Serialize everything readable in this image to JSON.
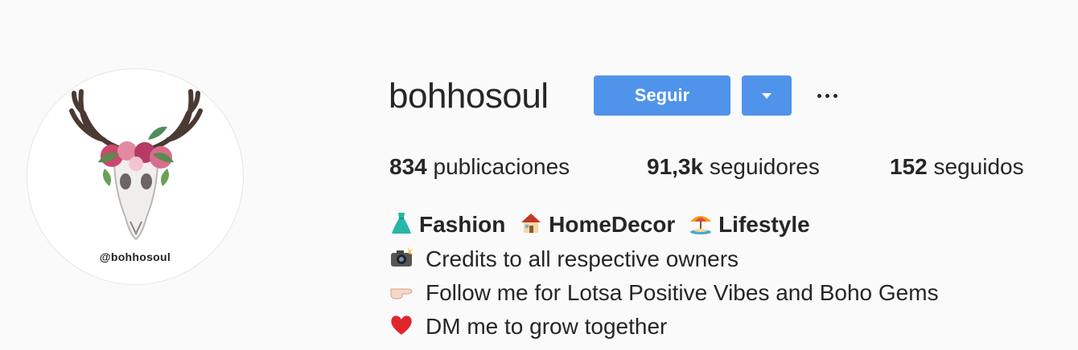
{
  "profile": {
    "avatar_handle": "@bohhosoul",
    "username": "bohhosoul",
    "follow_label": "Seguir"
  },
  "stats": {
    "posts_count": "834",
    "posts_label": "publicaciones",
    "followers_count": "91,3k",
    "followers_label": "seguidores",
    "following_count": "152",
    "following_label": "seguidos"
  },
  "bio": {
    "line1": {
      "fashion": "Fashion",
      "homedecor": "HomeDecor",
      "lifestyle": "Lifestyle"
    },
    "line2": "Credits to all respective owners",
    "line3": "Follow me for Lotsa Positive Vibes and Boho Gems",
    "line4": "DM me to grow together"
  },
  "icons": {
    "dress": "dress-icon",
    "house": "house-icon",
    "beach": "beach-umbrella-icon",
    "camera": "camera-flash-icon",
    "pointer": "pointing-hand-icon",
    "heart": "red-heart-icon"
  },
  "colors": {
    "accent": "#4f93ea",
    "background": "#fafafa",
    "text": "#262626"
  }
}
